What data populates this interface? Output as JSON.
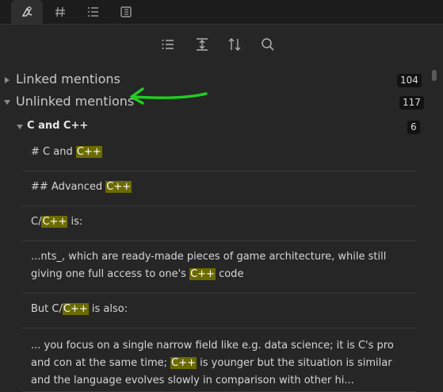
{
  "tabs": [
    {
      "icon": "backlinks-icon",
      "active": true
    },
    {
      "icon": "hashtag-icon",
      "active": false
    },
    {
      "icon": "list-icon",
      "active": false
    },
    {
      "icon": "outline-icon",
      "active": false
    }
  ],
  "toolbar": {
    "icons": [
      "list-icon",
      "expand-icon",
      "sort-icon",
      "search-icon"
    ]
  },
  "linked": {
    "label": "Linked mentions",
    "count": "104"
  },
  "unlinked": {
    "label": "Unlinked mentions",
    "count": "117"
  },
  "group": {
    "label": "C and C++",
    "count": "6"
  },
  "mentions": [
    {
      "lines": [
        [
          {
            "t": "# C and "
          },
          {
            "t": "C++",
            "hl": true
          }
        ]
      ]
    },
    {
      "lines": [
        [
          {
            "t": "## Advanced "
          },
          {
            "t": "C++",
            "hl": true
          }
        ]
      ]
    },
    {
      "lines": [
        [
          {
            "t": "C/"
          },
          {
            "t": "C++",
            "hl": true
          },
          {
            "t": " is:"
          }
        ]
      ]
    },
    {
      "lines": [
        [
          {
            "t": "...nts_, which are ready-made pieces of game architecture, while still"
          }
        ],
        [
          {
            "t": "giving one full access to one's "
          },
          {
            "t": "C++",
            "hl": true
          },
          {
            "t": " code"
          }
        ]
      ]
    },
    {
      "lines": [
        [
          {
            "t": "But C/"
          },
          {
            "t": "C++",
            "hl": true
          },
          {
            "t": " is also:"
          }
        ]
      ]
    },
    {
      "lines": [
        [
          {
            "t": "... you focus on a single narrow field like e.g. data science; it is C's pro"
          }
        ],
        [
          {
            "t": "and con at the same time; "
          },
          {
            "t": "C++",
            "hl": true
          },
          {
            "t": " is younger but the situation is similar"
          }
        ],
        [
          {
            "t": "and the language evolves slowly in comparison with other hi..."
          }
        ]
      ]
    }
  ],
  "colors": {
    "highlight": "#6b6b00",
    "annotation_arrow": "#22cc22"
  }
}
